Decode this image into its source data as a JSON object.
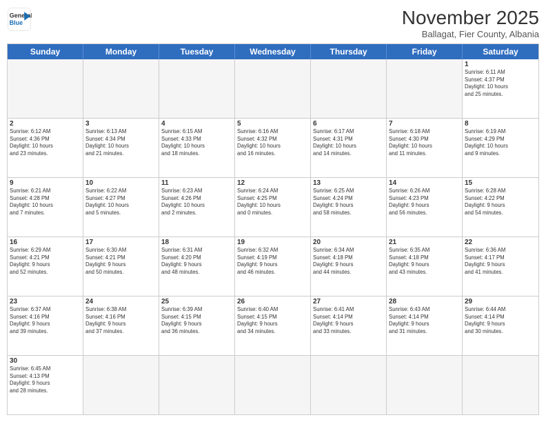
{
  "logo": {
    "line1": "General",
    "line2": "Blue"
  },
  "title": "November 2025",
  "subtitle": "Ballagat, Fier County, Albania",
  "days": [
    "Sunday",
    "Monday",
    "Tuesday",
    "Wednesday",
    "Thursday",
    "Friday",
    "Saturday"
  ],
  "rows": [
    [
      {
        "day": "",
        "info": "",
        "empty": true
      },
      {
        "day": "",
        "info": "",
        "empty": true
      },
      {
        "day": "",
        "info": "",
        "empty": true
      },
      {
        "day": "",
        "info": "",
        "empty": true
      },
      {
        "day": "",
        "info": "",
        "empty": true
      },
      {
        "day": "",
        "info": "",
        "empty": true
      },
      {
        "day": "1",
        "info": "Sunrise: 6:11 AM\nSunset: 4:37 PM\nDaylight: 10 hours\nand 25 minutes.",
        "empty": false
      }
    ],
    [
      {
        "day": "2",
        "info": "Sunrise: 6:12 AM\nSunset: 4:36 PM\nDaylight: 10 hours\nand 23 minutes.",
        "empty": false
      },
      {
        "day": "3",
        "info": "Sunrise: 6:13 AM\nSunset: 4:34 PM\nDaylight: 10 hours\nand 21 minutes.",
        "empty": false
      },
      {
        "day": "4",
        "info": "Sunrise: 6:15 AM\nSunset: 4:33 PM\nDaylight: 10 hours\nand 18 minutes.",
        "empty": false
      },
      {
        "day": "5",
        "info": "Sunrise: 6:16 AM\nSunset: 4:32 PM\nDaylight: 10 hours\nand 16 minutes.",
        "empty": false
      },
      {
        "day": "6",
        "info": "Sunrise: 6:17 AM\nSunset: 4:31 PM\nDaylight: 10 hours\nand 14 minutes.",
        "empty": false
      },
      {
        "day": "7",
        "info": "Sunrise: 6:18 AM\nSunset: 4:30 PM\nDaylight: 10 hours\nand 11 minutes.",
        "empty": false
      },
      {
        "day": "8",
        "info": "Sunrise: 6:19 AM\nSunset: 4:29 PM\nDaylight: 10 hours\nand 9 minutes.",
        "empty": false
      }
    ],
    [
      {
        "day": "9",
        "info": "Sunrise: 6:21 AM\nSunset: 4:28 PM\nDaylight: 10 hours\nand 7 minutes.",
        "empty": false
      },
      {
        "day": "10",
        "info": "Sunrise: 6:22 AM\nSunset: 4:27 PM\nDaylight: 10 hours\nand 5 minutes.",
        "empty": false
      },
      {
        "day": "11",
        "info": "Sunrise: 6:23 AM\nSunset: 4:26 PM\nDaylight: 10 hours\nand 2 minutes.",
        "empty": false
      },
      {
        "day": "12",
        "info": "Sunrise: 6:24 AM\nSunset: 4:25 PM\nDaylight: 10 hours\nand 0 minutes.",
        "empty": false
      },
      {
        "day": "13",
        "info": "Sunrise: 6:25 AM\nSunset: 4:24 PM\nDaylight: 9 hours\nand 58 minutes.",
        "empty": false
      },
      {
        "day": "14",
        "info": "Sunrise: 6:26 AM\nSunset: 4:23 PM\nDaylight: 9 hours\nand 56 minutes.",
        "empty": false
      },
      {
        "day": "15",
        "info": "Sunrise: 6:28 AM\nSunset: 4:22 PM\nDaylight: 9 hours\nand 54 minutes.",
        "empty": false
      }
    ],
    [
      {
        "day": "16",
        "info": "Sunrise: 6:29 AM\nSunset: 4:21 PM\nDaylight: 9 hours\nand 52 minutes.",
        "empty": false
      },
      {
        "day": "17",
        "info": "Sunrise: 6:30 AM\nSunset: 4:21 PM\nDaylight: 9 hours\nand 50 minutes.",
        "empty": false
      },
      {
        "day": "18",
        "info": "Sunrise: 6:31 AM\nSunset: 4:20 PM\nDaylight: 9 hours\nand 48 minutes.",
        "empty": false
      },
      {
        "day": "19",
        "info": "Sunrise: 6:32 AM\nSunset: 4:19 PM\nDaylight: 9 hours\nand 46 minutes.",
        "empty": false
      },
      {
        "day": "20",
        "info": "Sunrise: 6:34 AM\nSunset: 4:18 PM\nDaylight: 9 hours\nand 44 minutes.",
        "empty": false
      },
      {
        "day": "21",
        "info": "Sunrise: 6:35 AM\nSunset: 4:18 PM\nDaylight: 9 hours\nand 43 minutes.",
        "empty": false
      },
      {
        "day": "22",
        "info": "Sunrise: 6:36 AM\nSunset: 4:17 PM\nDaylight: 9 hours\nand 41 minutes.",
        "empty": false
      }
    ],
    [
      {
        "day": "23",
        "info": "Sunrise: 6:37 AM\nSunset: 4:16 PM\nDaylight: 9 hours\nand 39 minutes.",
        "empty": false
      },
      {
        "day": "24",
        "info": "Sunrise: 6:38 AM\nSunset: 4:16 PM\nDaylight: 9 hours\nand 37 minutes.",
        "empty": false
      },
      {
        "day": "25",
        "info": "Sunrise: 6:39 AM\nSunset: 4:15 PM\nDaylight: 9 hours\nand 36 minutes.",
        "empty": false
      },
      {
        "day": "26",
        "info": "Sunrise: 6:40 AM\nSunset: 4:15 PM\nDaylight: 9 hours\nand 34 minutes.",
        "empty": false
      },
      {
        "day": "27",
        "info": "Sunrise: 6:41 AM\nSunset: 4:14 PM\nDaylight: 9 hours\nand 33 minutes.",
        "empty": false
      },
      {
        "day": "28",
        "info": "Sunrise: 6:43 AM\nSunset: 4:14 PM\nDaylight: 9 hours\nand 31 minutes.",
        "empty": false
      },
      {
        "day": "29",
        "info": "Sunrise: 6:44 AM\nSunset: 4:14 PM\nDaylight: 9 hours\nand 30 minutes.",
        "empty": false
      }
    ],
    [
      {
        "day": "30",
        "info": "Sunrise: 6:45 AM\nSunset: 4:13 PM\nDaylight: 9 hours\nand 28 minutes.",
        "empty": false
      },
      {
        "day": "",
        "info": "",
        "empty": true
      },
      {
        "day": "",
        "info": "",
        "empty": true
      },
      {
        "day": "",
        "info": "",
        "empty": true
      },
      {
        "day": "",
        "info": "",
        "empty": true
      },
      {
        "day": "",
        "info": "",
        "empty": true
      },
      {
        "day": "",
        "info": "",
        "empty": true
      }
    ]
  ]
}
